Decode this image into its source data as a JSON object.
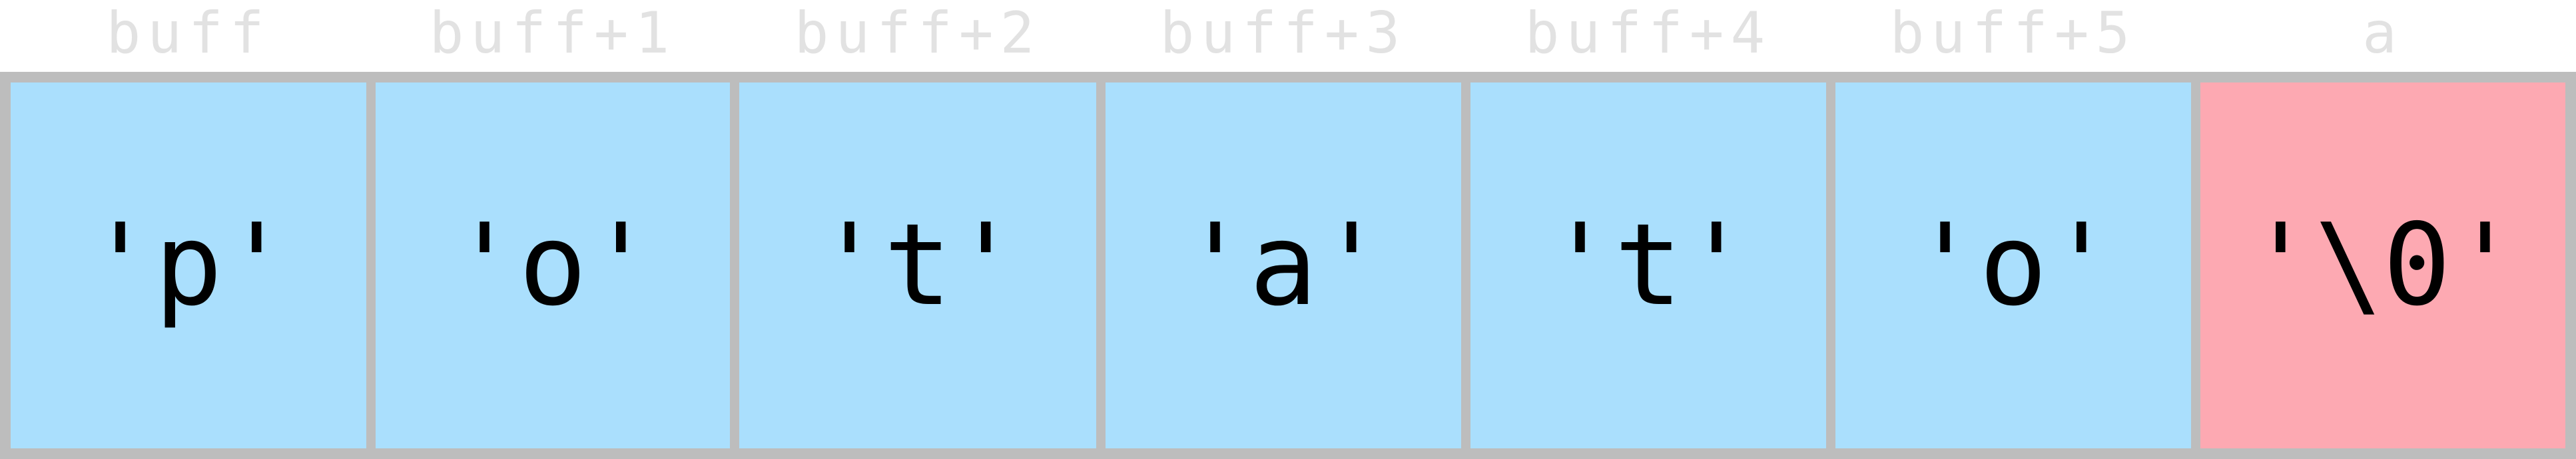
{
  "colors": {
    "buffer_cell": "#aadffd",
    "overflow_cell": "#fda9b2",
    "border": "#bdbdbd",
    "label_text": "#e2e2e2",
    "cell_text": "#000000"
  },
  "labels": [
    "buff",
    "buff+1",
    "buff+2",
    "buff+3",
    "buff+4",
    "buff+5",
    "a"
  ],
  "cells": [
    {
      "value": "'p'",
      "kind": "buffer"
    },
    {
      "value": "'o'",
      "kind": "buffer"
    },
    {
      "value": "'t'",
      "kind": "buffer"
    },
    {
      "value": "'a'",
      "kind": "buffer"
    },
    {
      "value": "'t'",
      "kind": "buffer"
    },
    {
      "value": "'o'",
      "kind": "buffer"
    },
    {
      "value": "'\\0'",
      "kind": "overflow"
    }
  ]
}
